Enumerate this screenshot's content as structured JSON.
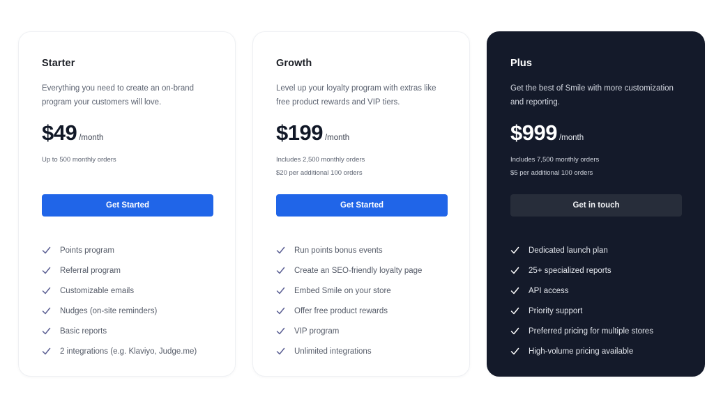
{
  "plans": [
    {
      "name": "Starter",
      "description": "Everything you need to create an on-brand program your customers will love.",
      "price": "$49",
      "period": "/month",
      "notes": [
        "Up to 500 monthly orders",
        ""
      ],
      "button_label": "Get Started",
      "features": [
        "Points program",
        "Referral program",
        "Customizable emails",
        "Nudges (on-site reminders)",
        "Basic reports",
        "2 integrations (e.g. Klaviyo, Judge.me)"
      ]
    },
    {
      "name": "Growth",
      "description": "Level up your loyalty program with extras like free product rewards and VIP tiers.",
      "price": "$199",
      "period": "/month",
      "notes": [
        "Includes 2,500 monthly orders",
        "$20 per additional 100 orders"
      ],
      "button_label": "Get Started",
      "features": [
        "Run points bonus events",
        "Create an SEO-friendly loyalty page",
        "Embed Smile on your store",
        "Offer free product rewards",
        "VIP program",
        "Unlimited integrations"
      ]
    },
    {
      "name": "Plus",
      "description": "Get the best of Smile with more customization and reporting.",
      "price": "$999",
      "period": "/month",
      "notes": [
        "Includes 7,500 monthly orders",
        "$5 per additional 100 orders"
      ],
      "button_label": "Get in touch",
      "features": [
        "Dedicated launch plan",
        "25+ specialized reports",
        "API access",
        "Priority support",
        "Preferred pricing for multiple stores",
        "High-volume pricing available"
      ]
    }
  ],
  "colors": {
    "primary_button": "#2065e8",
    "dark_card": "#141a2a",
    "dark_button": "#272d3a",
    "check_light": "#5b5f93"
  },
  "icons": {
    "feature_check": "check-icon"
  }
}
